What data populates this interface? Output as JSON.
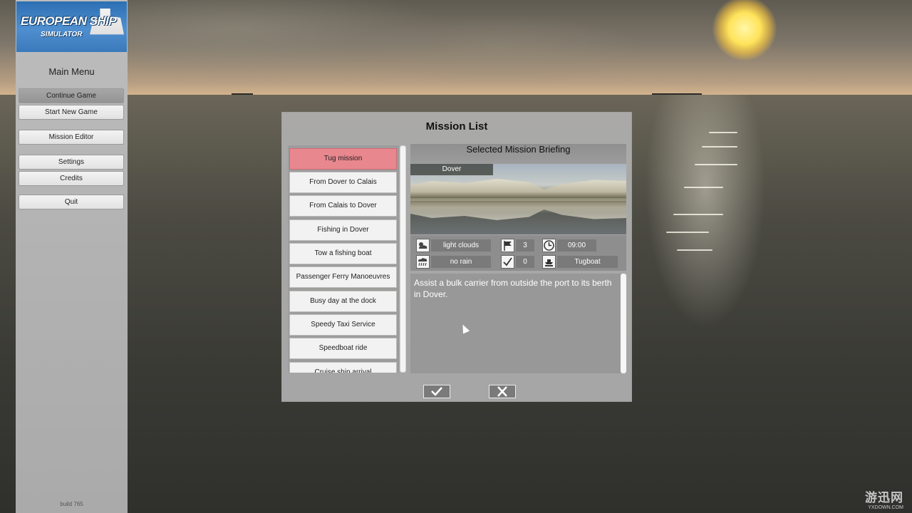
{
  "logo": {
    "line1": "EUROPEAN SHIP",
    "line2": "SIMULATOR"
  },
  "sidebar": {
    "title": "Main Menu",
    "buttons": [
      {
        "label": "Continue Game",
        "active": true
      },
      {
        "label": "Start New Game",
        "active": false
      },
      {
        "label": "Mission Editor",
        "active": false
      },
      {
        "label": "Settings",
        "active": false
      },
      {
        "label": "Credits",
        "active": false
      },
      {
        "label": "Quit",
        "active": false
      }
    ],
    "build": "build 765"
  },
  "dialog": {
    "title": "Mission List",
    "missions": [
      "Tug mission",
      "From Dover to Calais",
      "From Calais to Dover",
      "Fishing in Dover",
      "Tow a fishing boat",
      "Passenger Ferry Manoeuvres",
      "Busy day at the dock",
      "Speedy Taxi Service",
      "Speedboat ride",
      "Cruise ship arrival"
    ],
    "selected_index": 0,
    "briefing": {
      "title": "Selected Mission Briefing",
      "location": "Dover",
      "weather": "light clouds",
      "rain": "no rain",
      "flags": "3",
      "checks": "0",
      "time": "09:00",
      "ship": "Tugboat",
      "description": "Assist a bulk carrier from outside the port to its berth in Dover."
    },
    "icons": {
      "weather": "cloud-sun-icon",
      "rain": "rain-cloud-icon",
      "flags": "flag-icon",
      "checks": "checkmark-icon",
      "time": "clock-icon",
      "ship": "ship-name-icon",
      "confirm": "checkmark-icon",
      "cancel": "close-icon"
    }
  },
  "watermark": {
    "cn": "游迅网",
    "url": "YXDOWN.COM"
  },
  "colors": {
    "selected_mission": "#e8878e",
    "sidebar_bg": "#b5b5b5",
    "dialog_bg": "#b0b0b0"
  }
}
